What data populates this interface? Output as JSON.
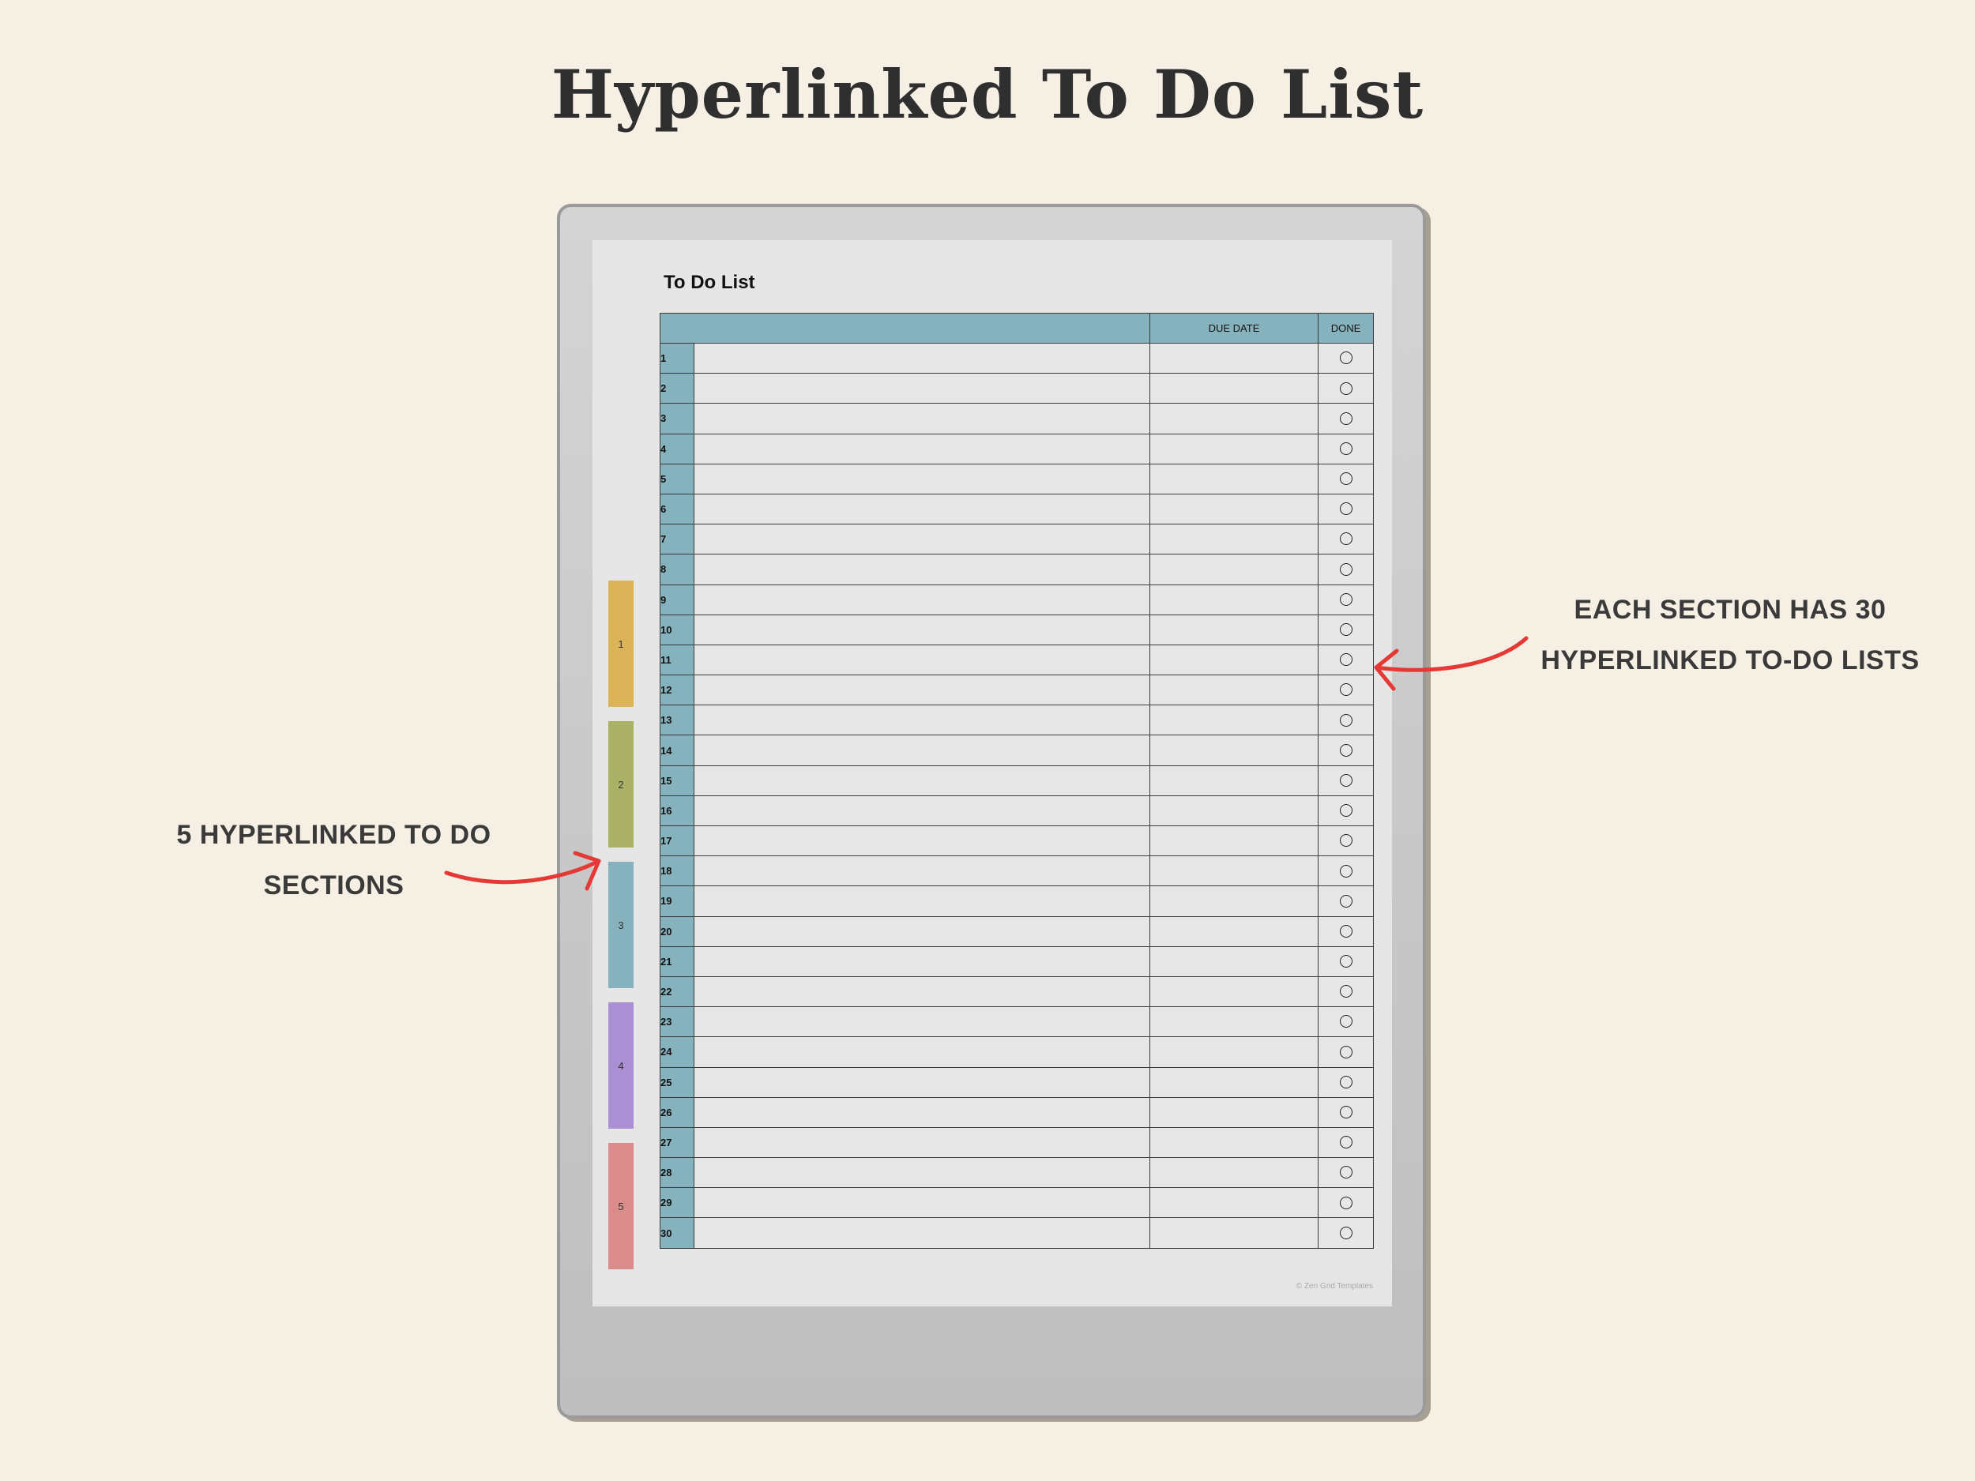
{
  "header": {
    "title": "Hyperlinked To Do List"
  },
  "page": {
    "title": "To Do List",
    "columns": {
      "task": "",
      "due_date": "DUE DATE",
      "done": "DONE"
    },
    "rows": [
      "1",
      "2",
      "3",
      "4",
      "5",
      "6",
      "7",
      "8",
      "9",
      "10",
      "11",
      "12",
      "13",
      "14",
      "15",
      "16",
      "17",
      "18",
      "19",
      "20",
      "21",
      "22",
      "23",
      "24",
      "25",
      "26",
      "27",
      "28",
      "29",
      "30"
    ],
    "footer": "© Zen Grid Templates"
  },
  "tabs": [
    {
      "label": "1",
      "color": "#dbb45a"
    },
    {
      "label": "2",
      "color": "#abb067"
    },
    {
      "label": "3",
      "color": "#86b2bd"
    },
    {
      "label": "4",
      "color": "#ab8fd3"
    },
    {
      "label": "5",
      "color": "#d98c8a"
    }
  ],
  "annotations": {
    "right_line1": "EACH SECTION HAS 30",
    "right_line2": "HYPERLINKED TO-DO LISTS",
    "left_line1": "5 HYPERLINKED TO DO",
    "left_line2": "SECTIONS"
  },
  "colors": {
    "background": "#f5efe4",
    "header_teal": "#86b2bd",
    "arrow": "#e53935"
  }
}
